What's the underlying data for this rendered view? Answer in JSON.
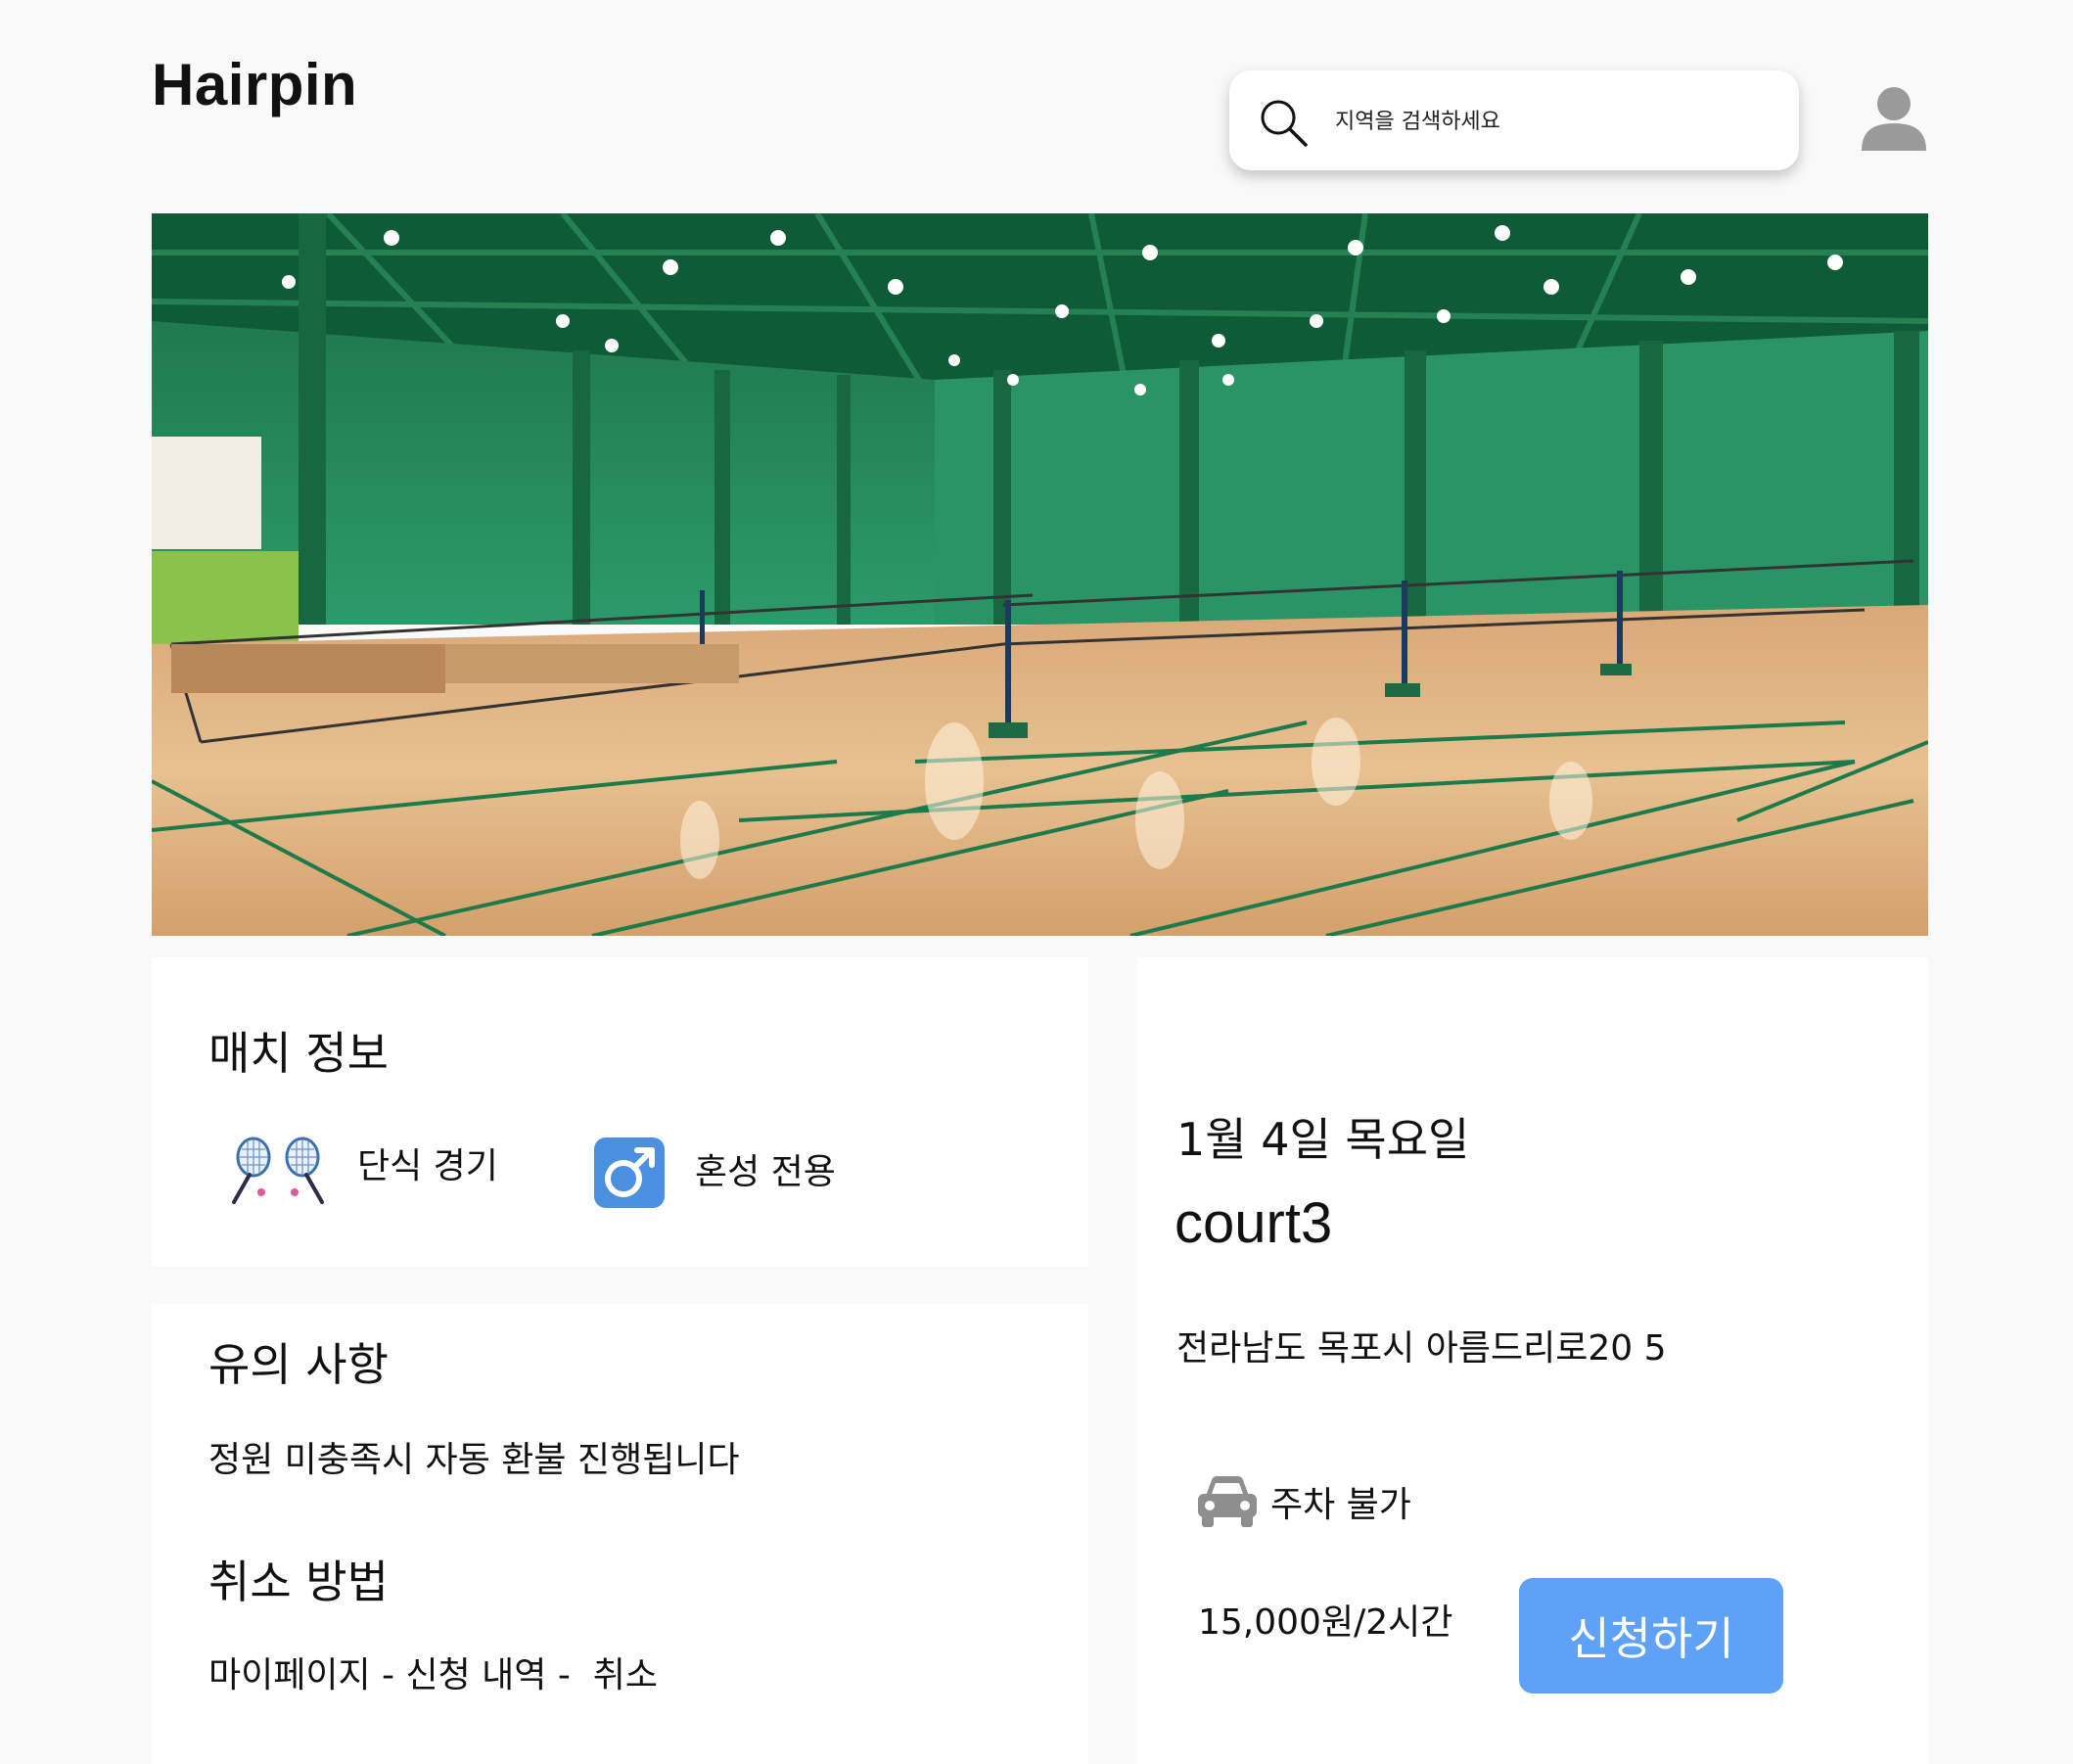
{
  "header": {
    "logo": "Hairpin",
    "search": {
      "placeholder": "지역을 검색하세요",
      "icon": "search-icon"
    },
    "avatar_icon": "user-avatar-icon"
  },
  "hero": {
    "description_icon": "court-photo"
  },
  "match_info": {
    "title": "매치 정보",
    "items": [
      {
        "icon": "badminton-rackets-icon",
        "label": "단식 경기"
      },
      {
        "icon": "male-sign-icon",
        "label": "혼성 전용"
      }
    ]
  },
  "notice": {
    "title": "유의 사항",
    "text": "정원 미충족시 자동 환불 진행됩니다",
    "cancel_title": "취소 방법",
    "cancel_text": "마이페이지 - 신청 내역 -  취소"
  },
  "booking": {
    "date": "1월 4일 목요일",
    "court": "court3",
    "address": "전라남도 목포시 아름드리로20 5",
    "parking": {
      "icon": "car-icon",
      "label": "주차 불가"
    },
    "price": "15,000원/2시간",
    "apply_label": "신청하기",
    "accent_color": "#5ea1f7"
  }
}
